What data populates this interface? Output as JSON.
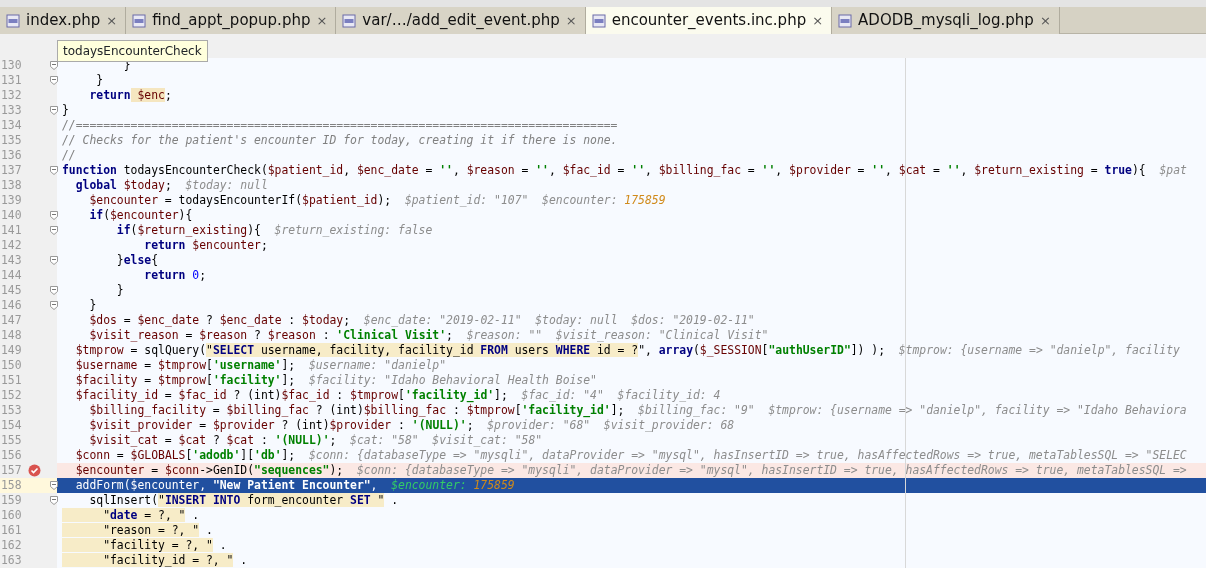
{
  "tabs": [
    {
      "label": "index.php",
      "close": "×",
      "selected": false
    },
    {
      "label": "find_appt_popup.php",
      "close": "×",
      "selected": false
    },
    {
      "label": "var/…/add_edit_event.php",
      "close": "×",
      "selected": false
    },
    {
      "label": "encounter_events.inc.php",
      "close": "×",
      "selected": true
    },
    {
      "label": "ADODB_mysqli_log.php",
      "close": "×",
      "selected": false
    }
  ],
  "tooltip": "todaysEncounterCheck",
  "lines": [
    {
      "number": "130",
      "kind": "normal",
      "fold": true,
      "code": [
        {
          "kind": "plain",
          "text": "         }"
        }
      ]
    },
    {
      "number": "131",
      "kind": "normal",
      "fold": true,
      "code": [
        {
          "kind": "plain",
          "text": "     }"
        }
      ]
    },
    {
      "number": "132",
      "kind": "normal",
      "fold": false,
      "code": [
        {
          "kind": "kw",
          "text": "    return"
        },
        {
          "kind": "varhl",
          "text": " $enc"
        },
        {
          "kind": "plain",
          "text": ";"
        }
      ]
    },
    {
      "number": "133",
      "kind": "normal",
      "fold": true,
      "code": [
        {
          "kind": "plain",
          "text": "}"
        }
      ]
    },
    {
      "number": "134",
      "kind": "normal",
      "fold": false,
      "code": [
        {
          "kind": "comment",
          "text": "//==============================================================================="
        }
      ]
    },
    {
      "number": "135",
      "kind": "normal",
      "fold": false,
      "code": [
        {
          "kind": "comment",
          "text": "// Checks for the patient's encounter ID for today, creating it if there is none."
        }
      ]
    },
    {
      "number": "136",
      "kind": "normal",
      "fold": false,
      "code": [
        {
          "kind": "comment",
          "text": "//"
        }
      ]
    },
    {
      "number": "137",
      "kind": "normal",
      "fold": true,
      "code": [
        {
          "kind": "kw",
          "text": "function"
        },
        {
          "kind": "plain",
          "text": " todaysEncounterCheck("
        },
        {
          "kind": "var",
          "text": "$patient_id"
        },
        {
          "kind": "plain",
          "text": ", "
        },
        {
          "kind": "var",
          "text": "$enc_date"
        },
        {
          "kind": "plain",
          "text": " = "
        },
        {
          "kind": "str",
          "text": "''"
        },
        {
          "kind": "plain",
          "text": ", "
        },
        {
          "kind": "var",
          "text": "$reason"
        },
        {
          "kind": "plain",
          "text": " = "
        },
        {
          "kind": "str",
          "text": "''"
        },
        {
          "kind": "plain",
          "text": ", "
        },
        {
          "kind": "var",
          "text": "$fac_id"
        },
        {
          "kind": "plain",
          "text": " = "
        },
        {
          "kind": "str",
          "text": "''"
        },
        {
          "kind": "plain",
          "text": ", "
        },
        {
          "kind": "var",
          "text": "$billing_fac"
        },
        {
          "kind": "plain",
          "text": " = "
        },
        {
          "kind": "str",
          "text": "''"
        },
        {
          "kind": "plain",
          "text": ", "
        },
        {
          "kind": "var",
          "text": "$provider"
        },
        {
          "kind": "plain",
          "text": " = "
        },
        {
          "kind": "str",
          "text": "''"
        },
        {
          "kind": "plain",
          "text": ", "
        },
        {
          "kind": "var",
          "text": "$cat"
        },
        {
          "kind": "plain",
          "text": " = "
        },
        {
          "kind": "str",
          "text": "''"
        },
        {
          "kind": "plain",
          "text": ", "
        },
        {
          "kind": "var",
          "text": "$return_existing"
        },
        {
          "kind": "plain",
          "text": " = "
        },
        {
          "kind": "kw",
          "text": "true"
        },
        {
          "kind": "plain",
          "text": "){"
        },
        {
          "kind": "hint",
          "text": "  $pat"
        }
      ]
    },
    {
      "number": "138",
      "kind": "normal",
      "fold": false,
      "code": [
        {
          "kind": "kw",
          "text": "  global"
        },
        {
          "kind": "var",
          "text": " $today"
        },
        {
          "kind": "plain",
          "text": ";"
        },
        {
          "kind": "hint",
          "text": "  $today: null"
        }
      ]
    },
    {
      "number": "139",
      "kind": "normal",
      "fold": false,
      "code": [
        {
          "kind": "var",
          "text": "    $encounter"
        },
        {
          "kind": "plain",
          "text": " = todaysEncounterIf("
        },
        {
          "kind": "var",
          "text": "$patient_id"
        },
        {
          "kind": "plain",
          "text": ");"
        },
        {
          "kind": "hint",
          "text": "  $patient_id: \"107\"  $encounter: "
        },
        {
          "kind": "hintnum",
          "text": "175859"
        }
      ]
    },
    {
      "number": "140",
      "kind": "normal",
      "fold": true,
      "code": [
        {
          "kind": "kw",
          "text": "    if"
        },
        {
          "kind": "plain",
          "text": "("
        },
        {
          "kind": "var",
          "text": "$encounter"
        },
        {
          "kind": "plain",
          "text": "){"
        }
      ]
    },
    {
      "number": "141",
      "kind": "normal",
      "fold": true,
      "code": [
        {
          "kind": "kw",
          "text": "        if"
        },
        {
          "kind": "plain",
          "text": "("
        },
        {
          "kind": "var",
          "text": "$return_existing"
        },
        {
          "kind": "plain",
          "text": "){"
        },
        {
          "kind": "hint",
          "text": "  $return_existing: false"
        }
      ]
    },
    {
      "number": "142",
      "kind": "normal",
      "fold": false,
      "code": [
        {
          "kind": "kw",
          "text": "            return"
        },
        {
          "kind": "var",
          "text": " $encounter"
        },
        {
          "kind": "plain",
          "text": ";"
        }
      ]
    },
    {
      "number": "143",
      "kind": "normal",
      "fold": true,
      "code": [
        {
          "kind": "plain",
          "text": "        }"
        },
        {
          "kind": "kw",
          "text": "else"
        },
        {
          "kind": "plain",
          "text": "{"
        }
      ]
    },
    {
      "number": "144",
      "kind": "normal",
      "fold": false,
      "code": [
        {
          "kind": "kw",
          "text": "            return"
        },
        {
          "kind": "num",
          "text": " 0"
        },
        {
          "kind": "plain",
          "text": ";"
        }
      ]
    },
    {
      "number": "145",
      "kind": "normal",
      "fold": true,
      "code": [
        {
          "kind": "plain",
          "text": "        }"
        }
      ]
    },
    {
      "number": "146",
      "kind": "normal",
      "fold": true,
      "code": [
        {
          "kind": "plain",
          "text": "    }"
        }
      ]
    },
    {
      "number": "147",
      "kind": "normal",
      "fold": false,
      "code": [
        {
          "kind": "var",
          "text": "    $dos"
        },
        {
          "kind": "plain",
          "text": " = "
        },
        {
          "kind": "var",
          "text": "$enc_date"
        },
        {
          "kind": "plain",
          "text": " ? "
        },
        {
          "kind": "var",
          "text": "$enc_date"
        },
        {
          "kind": "plain",
          "text": " : "
        },
        {
          "kind": "var",
          "text": "$today"
        },
        {
          "kind": "plain",
          "text": ";"
        },
        {
          "kind": "hint",
          "text": "  $enc_date: \"2019-02-11\"  $today: null  $dos: \"2019-02-11\""
        }
      ]
    },
    {
      "number": "148",
      "kind": "normal",
      "fold": false,
      "code": [
        {
          "kind": "var",
          "text": "    $visit_reason"
        },
        {
          "kind": "plain",
          "text": " = "
        },
        {
          "kind": "var",
          "text": "$reason"
        },
        {
          "kind": "plain",
          "text": " ? "
        },
        {
          "kind": "var",
          "text": "$reason"
        },
        {
          "kind": "plain",
          "text": " : "
        },
        {
          "kind": "str",
          "text": "'Clinical Visit'"
        },
        {
          "kind": "plain",
          "text": ";"
        },
        {
          "kind": "hint",
          "text": "  $reason: \"\"  $visit_reason: \"Clinical Visit\""
        }
      ]
    },
    {
      "number": "149",
      "kind": "normal",
      "fold": false,
      "code": [
        {
          "kind": "var",
          "text": "  $tmprow"
        },
        {
          "kind": "plain",
          "text": " = sqlQuery("
        },
        {
          "kind": "sql",
          "text": "\""
        },
        {
          "kind": "sqlkw",
          "text": "SELECT"
        },
        {
          "kind": "sql",
          "text": " username, facility, facility_id "
        },
        {
          "kind": "sqlkw",
          "text": "FROM"
        },
        {
          "kind": "sql",
          "text": " users "
        },
        {
          "kind": "sqlkw",
          "text": "WHERE"
        },
        {
          "kind": "sql",
          "text": " id = ?"
        },
        {
          "kind": "plain",
          "text": "\", "
        },
        {
          "kind": "kw",
          "text": "array"
        },
        {
          "kind": "plain",
          "text": "("
        },
        {
          "kind": "var",
          "text": "$_SESSION"
        },
        {
          "kind": "plain",
          "text": "["
        },
        {
          "kind": "str",
          "text": "\"authUserID\""
        },
        {
          "kind": "plain",
          "text": "]) );"
        },
        {
          "kind": "hint",
          "text": "  $tmprow: {username => \"danielp\", facility"
        }
      ]
    },
    {
      "number": "150",
      "kind": "normal",
      "fold": false,
      "code": [
        {
          "kind": "var",
          "text": "  $username"
        },
        {
          "kind": "plain",
          "text": " = "
        },
        {
          "kind": "var",
          "text": "$tmprow"
        },
        {
          "kind": "plain",
          "text": "["
        },
        {
          "kind": "str",
          "text": "'username'"
        },
        {
          "kind": "plain",
          "text": "];"
        },
        {
          "kind": "hint",
          "text": "  $username: \"danielp\""
        }
      ]
    },
    {
      "number": "151",
      "kind": "normal",
      "fold": false,
      "code": [
        {
          "kind": "var",
          "text": "  $facility"
        },
        {
          "kind": "plain",
          "text": " = "
        },
        {
          "kind": "var",
          "text": "$tmprow"
        },
        {
          "kind": "plain",
          "text": "["
        },
        {
          "kind": "str",
          "text": "'facility'"
        },
        {
          "kind": "plain",
          "text": "];"
        },
        {
          "kind": "hint",
          "text": "  $facility: \"Idaho Behavioral Health Boise\""
        }
      ]
    },
    {
      "number": "152",
      "kind": "normal",
      "fold": false,
      "code": [
        {
          "kind": "var",
          "text": "  $facility_id"
        },
        {
          "kind": "plain",
          "text": " = "
        },
        {
          "kind": "var",
          "text": "$fac_id"
        },
        {
          "kind": "plain",
          "text": " ? (int)"
        },
        {
          "kind": "var",
          "text": "$fac_id"
        },
        {
          "kind": "plain",
          "text": " : "
        },
        {
          "kind": "var",
          "text": "$tmprow"
        },
        {
          "kind": "plain",
          "text": "["
        },
        {
          "kind": "str",
          "text": "'facility_id'"
        },
        {
          "kind": "plain",
          "text": "];"
        },
        {
          "kind": "hint",
          "text": "  $fac_id: \"4\"  $facility_id: 4"
        }
      ]
    },
    {
      "number": "153",
      "kind": "normal",
      "fold": false,
      "code": [
        {
          "kind": "var",
          "text": "    $billing_facility"
        },
        {
          "kind": "plain",
          "text": " = "
        },
        {
          "kind": "var",
          "text": "$billing_fac"
        },
        {
          "kind": "plain",
          "text": " ? (int)"
        },
        {
          "kind": "var",
          "text": "$billing_fac"
        },
        {
          "kind": "plain",
          "text": " : "
        },
        {
          "kind": "var",
          "text": "$tmprow"
        },
        {
          "kind": "plain",
          "text": "["
        },
        {
          "kind": "str",
          "text": "'facility_id'"
        },
        {
          "kind": "plain",
          "text": "];"
        },
        {
          "kind": "hint",
          "text": "  $billing_fac: \"9\"  $tmprow: {username => \"danielp\", facility => \"Idaho Behaviora"
        }
      ]
    },
    {
      "number": "154",
      "kind": "normal",
      "fold": false,
      "code": [
        {
          "kind": "var",
          "text": "    $visit_provider"
        },
        {
          "kind": "plain",
          "text": " = "
        },
        {
          "kind": "var",
          "text": "$provider"
        },
        {
          "kind": "plain",
          "text": " ? (int)"
        },
        {
          "kind": "var",
          "text": "$provider"
        },
        {
          "kind": "plain",
          "text": " : "
        },
        {
          "kind": "str",
          "text": "'(NULL)'"
        },
        {
          "kind": "plain",
          "text": ";"
        },
        {
          "kind": "hint",
          "text": "  $provider: \"68\"  $visit_provider: 68"
        }
      ]
    },
    {
      "number": "155",
      "kind": "normal",
      "fold": false,
      "code": [
        {
          "kind": "var",
          "text": "    $visit_cat"
        },
        {
          "kind": "plain",
          "text": " = "
        },
        {
          "kind": "var",
          "text": "$cat"
        },
        {
          "kind": "plain",
          "text": " ? "
        },
        {
          "kind": "var",
          "text": "$cat"
        },
        {
          "kind": "plain",
          "text": " : "
        },
        {
          "kind": "str",
          "text": "'(NULL)'"
        },
        {
          "kind": "plain",
          "text": ";"
        },
        {
          "kind": "hint",
          "text": "  $cat: \"58\"  $visit_cat: \"58\""
        }
      ]
    },
    {
      "number": "156",
      "kind": "normal",
      "fold": false,
      "code": [
        {
          "kind": "var",
          "text": "  $conn"
        },
        {
          "kind": "plain",
          "text": " = "
        },
        {
          "kind": "var",
          "text": "$GLOBALS"
        },
        {
          "kind": "plain",
          "text": "["
        },
        {
          "kind": "str",
          "text": "'adodb'"
        },
        {
          "kind": "plain",
          "text": "]["
        },
        {
          "kind": "str",
          "text": "'db'"
        },
        {
          "kind": "plain",
          "text": "];"
        },
        {
          "kind": "hint",
          "text": "  $conn: {databaseType => \"mysqli\", dataProvider => \"mysql\", hasInsertID => true, hasAffectedRows => true, metaTablesSQL => \"SELEC"
        }
      ]
    },
    {
      "number": "157",
      "kind": "breakpoint",
      "fold": false,
      "code": [
        {
          "kind": "var",
          "text": "  $encounter"
        },
        {
          "kind": "plain",
          "text": " = "
        },
        {
          "kind": "var",
          "text": "$conn"
        },
        {
          "kind": "plain",
          "text": "->GenID("
        },
        {
          "kind": "str",
          "text": "\"sequences\""
        },
        {
          "kind": "plain",
          "text": ");"
        },
        {
          "kind": "hint",
          "text": "  $conn: {databaseType => \"mysqli\", dataProvider => \"mysql\", hasInsertID => true, hasAffectedRows => true, metaTablesSQL =>"
        }
      ]
    },
    {
      "number": "158",
      "kind": "current",
      "fold": true,
      "code": [
        {
          "kind": "plain",
          "text": "  addForm("
        },
        {
          "kind": "var",
          "text": "$encounter"
        },
        {
          "kind": "plain",
          "text": ", "
        },
        {
          "kind": "str",
          "text": "\"New Patient Encounter\""
        },
        {
          "kind": "plain",
          "text": ","
        },
        {
          "kind": "hint",
          "text": "  $encounter: "
        },
        {
          "kind": "hintnum",
          "text": "175859"
        }
      ]
    },
    {
      "number": "159",
      "kind": "normal",
      "fold": true,
      "code": [
        {
          "kind": "plain",
          "text": "    sqlInsert("
        },
        {
          "kind": "sql",
          "text": "\""
        },
        {
          "kind": "sqlkw",
          "text": "INSERT INTO"
        },
        {
          "kind": "sql",
          "text": " form_encounter "
        },
        {
          "kind": "sqlkw",
          "text": "SET"
        },
        {
          "kind": "sql",
          "text": " \""
        },
        {
          "kind": "plain",
          "text": " ."
        }
      ]
    },
    {
      "number": "160",
      "kind": "normal",
      "fold": false,
      "code": [
        {
          "kind": "sql",
          "text": "      \""
        },
        {
          "kind": "sqlkw",
          "text": "date"
        },
        {
          "kind": "sql",
          "text": " = ?, \""
        },
        {
          "kind": "plain",
          "text": " ."
        }
      ]
    },
    {
      "number": "161",
      "kind": "normal",
      "fold": false,
      "code": [
        {
          "kind": "sql",
          "text": "      \"reason = ?, \""
        },
        {
          "kind": "plain",
          "text": " ."
        }
      ]
    },
    {
      "number": "162",
      "kind": "normal",
      "fold": false,
      "code": [
        {
          "kind": "sql",
          "text": "      \"facility = ?, \""
        },
        {
          "kind": "plain",
          "text": " ."
        }
      ]
    },
    {
      "number": "163",
      "kind": "normal",
      "fold": false,
      "code": [
        {
          "kind": "sql",
          "text": "      \"facility_id = ?, \""
        },
        {
          "kind": "plain",
          "text": " ."
        }
      ]
    }
  ]
}
